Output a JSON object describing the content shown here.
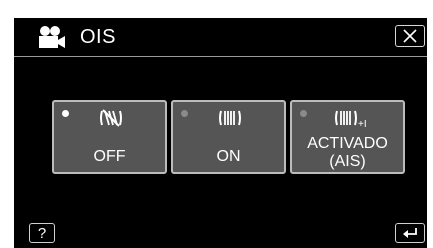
{
  "header": {
    "title": "OIS",
    "icon": "video-camera-icon"
  },
  "options": [
    {
      "label": "OFF",
      "icon": "stabilizer-off-icon",
      "selected": true
    },
    {
      "label": "ON",
      "icon": "stabilizer-on-icon",
      "selected": false
    },
    {
      "label_line1": "ACTIVADO",
      "label_line2": "(AIS)",
      "icon": "stabilizer-ais-icon",
      "icon_suffix": "+I",
      "selected": false
    }
  ],
  "footer": {
    "help_label": "?",
    "back_icon": "return-icon"
  },
  "colors": {
    "background": "#000000",
    "option_fill": "#555555",
    "option_border": "#bcbcbc",
    "text": "#ffffff"
  }
}
